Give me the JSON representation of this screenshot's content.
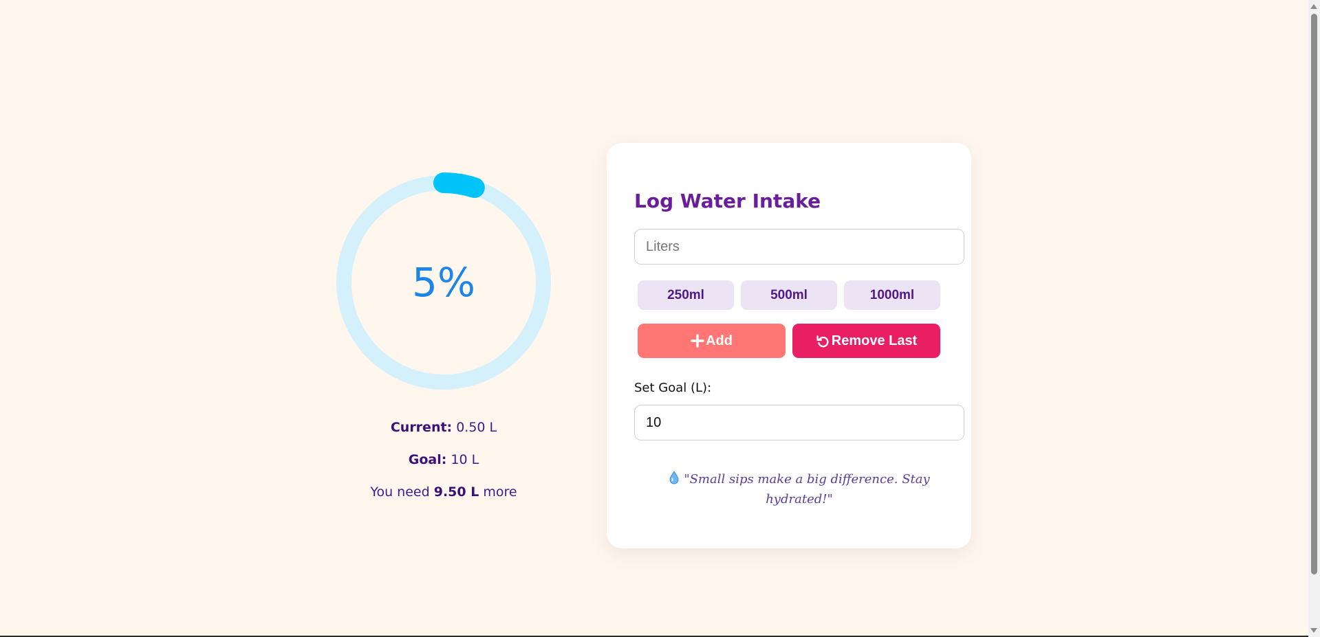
{
  "progress": {
    "percent_label": "5%",
    "fraction": 0.05,
    "track_color": "#d4f1fb",
    "fill_color": "#00c3f7"
  },
  "stats": {
    "current_label": "Current:",
    "current_value": "0.50 L",
    "goal_label": "Goal:",
    "goal_value": "10 L",
    "need_prefix": "You need",
    "need_value": "9.50 L",
    "need_suffix": "more"
  },
  "card": {
    "title": "Log Water Intake",
    "liters_placeholder": "Liters",
    "quick_add": [
      "250ml",
      "500ml",
      "1000ml"
    ],
    "add_label": "Add",
    "add_icon": "plus-icon",
    "remove_label": "Remove Last",
    "remove_icon": "undo-icon",
    "goal_field_label": "Set Goal (L):",
    "goal_value": "10",
    "quote_icon": "water-drop-icon",
    "quote": "\"Small sips make a big difference. Stay hydrated!\""
  },
  "colors": {
    "background": "#fff6ee",
    "add_button": "#ff7675",
    "remove_button": "#e91e63",
    "quick_button": "#ece4f4",
    "title": "#6a1e9a"
  }
}
